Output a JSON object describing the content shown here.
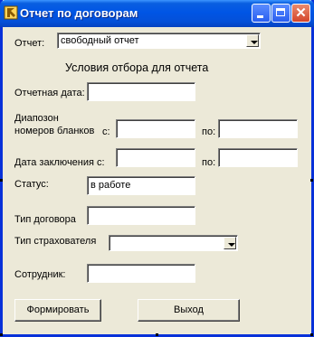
{
  "window": {
    "title": "Отчет по договорам"
  },
  "report": {
    "label": "Отчет:",
    "value": "свободный отчет"
  },
  "section_title": "Условия отбора для отчета",
  "report_date": {
    "label": "Отчетная дата:",
    "value": ""
  },
  "blank_range": {
    "label_line1": "Диапозон",
    "label_line2": "номеров бланков",
    "from_label": "с:",
    "to_label": "по:",
    "from_value": "",
    "to_value": ""
  },
  "contract_date": {
    "label": "Дата заключения с:",
    "to_label": "по:",
    "from_value": "",
    "to_value": ""
  },
  "status": {
    "label": "Статус:",
    "value": "в работе"
  },
  "contract_type": {
    "label": "Тип договора",
    "value": ""
  },
  "insurer_type": {
    "label": "Тип страхователя",
    "value": ""
  },
  "employee": {
    "label": "Сотрудник:",
    "value": ""
  },
  "buttons": {
    "generate": "Формировать",
    "exit": "Выход"
  },
  "colors": {
    "titlebar": "#0055e5",
    "form_bg": "#ece9d8",
    "border": "#0831d9"
  }
}
